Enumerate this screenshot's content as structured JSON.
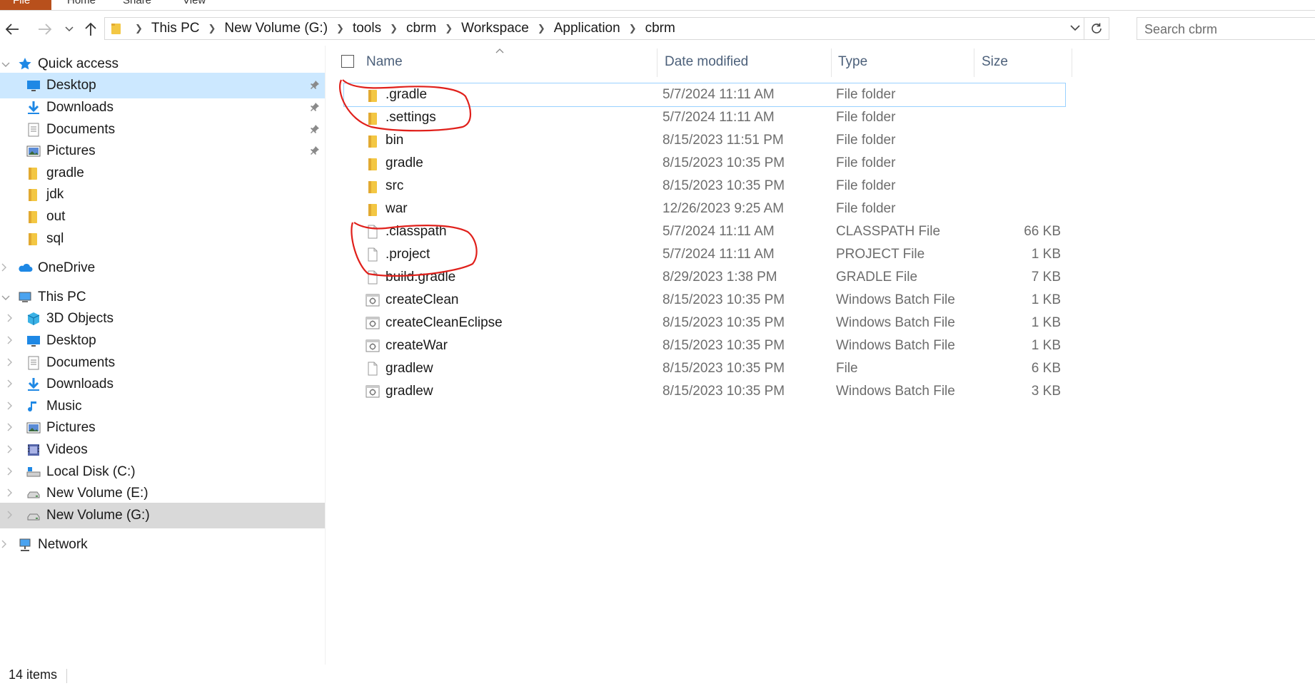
{
  "ribbon": {
    "file": "File",
    "home": "Home",
    "share": "Share",
    "view": "View"
  },
  "address": {
    "crumbs": [
      "This PC",
      "New Volume (G:)",
      "tools",
      "cbrm",
      "Workspace",
      "Application",
      "cbrm"
    ]
  },
  "search": {
    "placeholder": "Search cbrm"
  },
  "columns": {
    "name": "Name",
    "date": "Date modified",
    "type": "Type",
    "size": "Size"
  },
  "nav": [
    {
      "label": "Quick access",
      "icon": "star-icon",
      "level": 0,
      "chevron": "down"
    },
    {
      "label": "Desktop",
      "icon": "desktop-icon",
      "level": 1,
      "pinned": true,
      "selected": true
    },
    {
      "label": "Downloads",
      "icon": "download-icon",
      "level": 1,
      "pinned": true
    },
    {
      "label": "Documents",
      "icon": "documents-icon",
      "level": 1,
      "pinned": true
    },
    {
      "label": "Pictures",
      "icon": "pictures-icon",
      "level": 1,
      "pinned": true
    },
    {
      "label": "gradle",
      "icon": "folder-icon",
      "level": 1
    },
    {
      "label": "jdk",
      "icon": "folder-icon",
      "level": 1
    },
    {
      "label": "out",
      "icon": "folder-icon",
      "level": 1
    },
    {
      "label": "sql",
      "icon": "folder-icon",
      "level": 1
    },
    {
      "label": "OneDrive",
      "icon": "onedrive-icon",
      "level": 0,
      "chevron": "right"
    },
    {
      "label": "This PC",
      "icon": "this-pc-icon",
      "level": 0,
      "chevron": "down"
    },
    {
      "label": "3D Objects",
      "icon": "3d-objects-icon",
      "level": 1,
      "chevron": "right"
    },
    {
      "label": "Desktop",
      "icon": "desktop-icon",
      "level": 1,
      "chevron": "right"
    },
    {
      "label": "Documents",
      "icon": "documents-icon",
      "level": 1,
      "chevron": "right"
    },
    {
      "label": "Downloads",
      "icon": "download-icon",
      "level": 1,
      "chevron": "right"
    },
    {
      "label": "Music",
      "icon": "music-icon",
      "level": 1,
      "chevron": "right"
    },
    {
      "label": "Pictures",
      "icon": "pictures-icon",
      "level": 1,
      "chevron": "right"
    },
    {
      "label": "Videos",
      "icon": "videos-icon",
      "level": 1,
      "chevron": "right"
    },
    {
      "label": "Local Disk (C:)",
      "icon": "local-disk-icon",
      "level": 1,
      "chevron": "right"
    },
    {
      "label": "New Volume (E:)",
      "icon": "drive-icon",
      "level": 1,
      "chevron": "right"
    },
    {
      "label": "New Volume (G:)",
      "icon": "drive-icon",
      "level": 1,
      "chevron": "right",
      "current": true
    },
    {
      "label": "Network",
      "icon": "network-icon",
      "level": 0,
      "chevron": "right"
    }
  ],
  "files": [
    {
      "name": ".gradle",
      "date": "5/7/2024 11:11 AM",
      "type": "File folder",
      "size": "",
      "icon": "folder-icon",
      "focused": true
    },
    {
      "name": ".settings",
      "date": "5/7/2024 11:11 AM",
      "type": "File folder",
      "size": "",
      "icon": "folder-icon"
    },
    {
      "name": "bin",
      "date": "8/15/2023 11:51 PM",
      "type": "File folder",
      "size": "",
      "icon": "folder-icon"
    },
    {
      "name": "gradle",
      "date": "8/15/2023 10:35 PM",
      "type": "File folder",
      "size": "",
      "icon": "folder-icon"
    },
    {
      "name": "src",
      "date": "8/15/2023 10:35 PM",
      "type": "File folder",
      "size": "",
      "icon": "folder-icon"
    },
    {
      "name": "war",
      "date": "12/26/2023 9:25 AM",
      "type": "File folder",
      "size": "",
      "icon": "folder-icon"
    },
    {
      "name": ".classpath",
      "date": "5/7/2024 11:11 AM",
      "type": "CLASSPATH File",
      "size": "66 KB",
      "icon": "file-icon"
    },
    {
      "name": ".project",
      "date": "5/7/2024 11:11 AM",
      "type": "PROJECT File",
      "size": "1 KB",
      "icon": "file-icon"
    },
    {
      "name": "build.gradle",
      "date": "8/29/2023 1:38 PM",
      "type": "GRADLE File",
      "size": "7 KB",
      "icon": "file-icon"
    },
    {
      "name": "createClean",
      "date": "8/15/2023 10:35 PM",
      "type": "Windows Batch File",
      "size": "1 KB",
      "icon": "batch-file-icon"
    },
    {
      "name": "createCleanEclipse",
      "date": "8/15/2023 10:35 PM",
      "type": "Windows Batch File",
      "size": "1 KB",
      "icon": "batch-file-icon"
    },
    {
      "name": "createWar",
      "date": "8/15/2023 10:35 PM",
      "type": "Windows Batch File",
      "size": "1 KB",
      "icon": "batch-file-icon"
    },
    {
      "name": "gradlew",
      "date": "8/15/2023 10:35 PM",
      "type": "File",
      "size": "6 KB",
      "icon": "file-icon"
    },
    {
      "name": "gradlew",
      "date": "8/15/2023 10:35 PM",
      "type": "Windows Batch File",
      "size": "3 KB",
      "icon": "batch-file-icon"
    }
  ],
  "status": {
    "count": "14 items"
  },
  "colors": {
    "selection": "#cce8ff",
    "current": "#d9d9d9",
    "annotation": "#e0201b",
    "folder": "#f3c743"
  }
}
